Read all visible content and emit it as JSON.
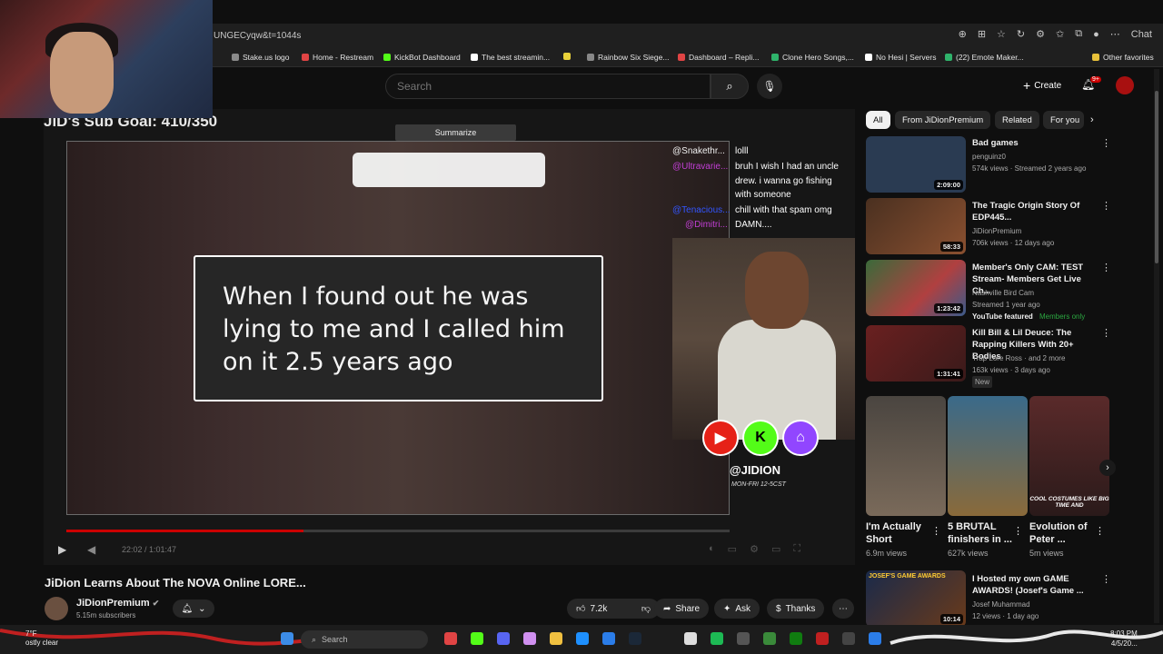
{
  "browser": {
    "url": "UNGECyqw&t=1044s",
    "chat_label": "Chat",
    "bookmarks": [
      {
        "label": "Stake.us logo",
        "color": "#8a8a8a"
      },
      {
        "label": "Home - Restream",
        "color": "#e04444"
      },
      {
        "label": "KickBot Dashboard",
        "color": "#53fc18"
      },
      {
        "label": "The best streamin...",
        "color": "#ffffff"
      },
      {
        "label": "",
        "color": "#e8d13a"
      },
      {
        "label": "Rainbow Six Siege...",
        "color": "#888888"
      },
      {
        "label": "Dashboard – Repli...",
        "color": "#e04444"
      },
      {
        "label": "Clone Hero Songs,...",
        "color": "#2fb36b"
      },
      {
        "label": "No Hesi | Servers",
        "color": "#ffffff"
      },
      {
        "label": "(22) Emote Maker...",
        "color": "#2fb36b"
      },
      {
        "label": "Other favorites",
        "color": "#e8c13a"
      }
    ]
  },
  "header": {
    "search_placeholder": "Search",
    "create_label": "Create",
    "notif_count": "9+"
  },
  "video": {
    "sub_goal": "JiD's Sub Goal: 410/350",
    "summarize": "Summarize",
    "caption": "When I found out he was lying to me and I called him on it 2.5 years ago",
    "chat": [
      {
        "user": "@Snakethr...",
        "color": "#1fb5a5",
        "msg": "lolll"
      },
      {
        "user": "@Ultravarie...",
        "color": "#c33fd6",
        "msg": "bruh I wish I had an uncle"
      },
      {
        "user": "",
        "color": "#ffffff",
        "msg": "drew. i wanna go fishing"
      },
      {
        "user": "",
        "color": "#ffffff",
        "msg": "with someone"
      },
      {
        "user": "@Tenacious...",
        "color": "#3355ff",
        "msg": "chill with that spam omg"
      },
      {
        "user": "@Dimitri...",
        "color": "#c33fd6",
        "msg": "DAMN...."
      }
    ],
    "handle": "@JIDION",
    "schedule": "MON-FRI 12-5CST",
    "time": "22:02 / 1:01:47",
    "progress": 0.357,
    "title": "JiDion Learns About The NOVA Online LORE...",
    "channel": "JiDionPremium",
    "subscribers": "5.15m subscribers",
    "likes": "7.2k",
    "share": "Share",
    "ask": "Ask",
    "thanks": "Thanks"
  },
  "sidebar": {
    "chips": [
      "All",
      "From JiDionPremium",
      "Related",
      "For you"
    ],
    "recs": [
      {
        "title": "Bad games",
        "channel": "penguinz0",
        "meta": "574k views · Streamed 2 years ago",
        "extra": "",
        "duration": "2:09:00",
        "bg": "#2a3b52"
      },
      {
        "title": "The Tragic Origin Story Of EDP445...",
        "channel": "JiDionPremium",
        "meta": "706k views · 12 days ago",
        "extra": "",
        "duration": "58:33",
        "bg": "#4a3020"
      },
      {
        "title": "Member's Only CAM: TEST Stream- Members Get Live Ch...",
        "channel": "Nashville Bird Cam",
        "meta": "Streamed 1 year ago",
        "extra": "YouTube featured",
        "members": "Members only",
        "duration": "1:23:42",
        "bg": "#3a6a3a"
      },
      {
        "title": "Kill Bill & Lil Deuce: The Rapping Killers With 20+ Bodies",
        "channel": "Trap Lore Ross",
        "channel_extra": "and 2 more",
        "meta": "163k views · 3 days ago",
        "extra": "New",
        "duration": "1:31:41",
        "bg": "#6a2020"
      }
    ],
    "shorts": [
      {
        "title": "I'm Actually Short",
        "views": "6.9m views",
        "bg": "#4a4540"
      },
      {
        "title": "5 BRUTAL finishers in ...",
        "views": "627k views",
        "bg": "#3a6a8a"
      },
      {
        "title": "Evolution of Peter ...",
        "views": "5m views",
        "bg": "#5a2a2a",
        "overlay": "COOL COSTUMES LIKE BIG TIME AND"
      }
    ],
    "last": {
      "title": "I Hosted my own GAME AWARDS! (Josef's Game ...",
      "channel": "Josef Muhammad",
      "meta": "12 views · 1 day ago",
      "thumb_text": "JOSEF'S GAME AWARDS",
      "duration": "10:14"
    }
  },
  "taskbar": {
    "search": "Search",
    "weather_temp": "7°F",
    "weather_desc": "ostly clear",
    "time": "8:03 PM",
    "date": "4/5/20..."
  }
}
